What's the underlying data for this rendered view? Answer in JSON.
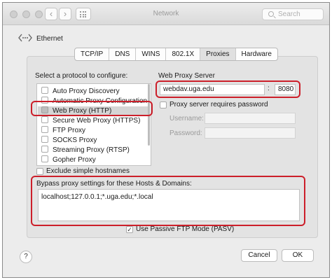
{
  "window": {
    "title": "Network",
    "search_placeholder": "Search"
  },
  "nav": {
    "back_glyph": "‹",
    "forward_glyph": "›"
  },
  "connection": {
    "name": "Ethernet"
  },
  "tabs": [
    {
      "label": "TCP/IP",
      "active": false
    },
    {
      "label": "DNS",
      "active": false
    },
    {
      "label": "WINS",
      "active": false
    },
    {
      "label": "802.1X",
      "active": false
    },
    {
      "label": "Proxies",
      "active": true
    },
    {
      "label": "Hardware",
      "active": false
    }
  ],
  "protocols": {
    "heading": "Select a protocol to configure:",
    "items": [
      {
        "label": "Auto Proxy Discovery",
        "checked": false,
        "selected": false
      },
      {
        "label": "Automatic Proxy Configuration",
        "checked": false,
        "selected": false
      },
      {
        "label": "Web Proxy (HTTP)",
        "checked": false,
        "selected": true
      },
      {
        "label": "Secure Web Proxy (HTTPS)",
        "checked": false,
        "selected": false
      },
      {
        "label": "FTP Proxy",
        "checked": false,
        "selected": false
      },
      {
        "label": "SOCKS Proxy",
        "checked": false,
        "selected": false
      },
      {
        "label": "Streaming Proxy (RTSP)",
        "checked": false,
        "selected": false
      },
      {
        "label": "Gopher Proxy",
        "checked": false,
        "selected": false
      }
    ]
  },
  "exclude_simple": {
    "label": "Exclude simple hostnames",
    "checked": false
  },
  "web_proxy": {
    "heading": "Web Proxy Server",
    "server": "webdav.uga.edu",
    "separator": ":",
    "port": "8080",
    "requires_password_label": "Proxy server requires password",
    "requires_password_checked": false,
    "username_label": "Username:",
    "password_label": "Password:",
    "username_value": "",
    "password_value": ""
  },
  "bypass": {
    "label": "Bypass proxy settings for these Hosts & Domains:",
    "value": "localhost;127.0.0.1;*.uga.edu;*.local"
  },
  "passive_ftp": {
    "label": "Use Passive FTP Mode (PASV)",
    "checked": true,
    "check_glyph": "✓"
  },
  "buttons": {
    "help": "?",
    "cancel": "Cancel",
    "ok": "OK"
  },
  "colors": {
    "highlight": "#cc1f2a",
    "selection": "#d5d5d5"
  }
}
